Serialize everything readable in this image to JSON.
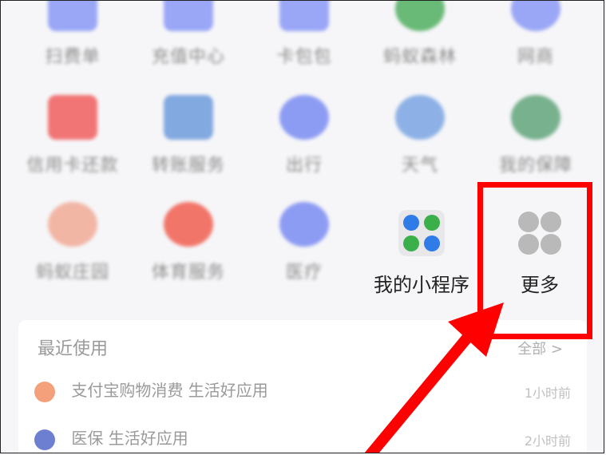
{
  "background_apps": [
    {
      "row": 0,
      "label": "扫费单",
      "color": "#7b8cf5",
      "shape": "sq"
    },
    {
      "row": 0,
      "label": "充值中心",
      "color": "#7b8cf5",
      "shape": "sq"
    },
    {
      "row": 0,
      "label": "卡包包",
      "color": "#7b8cf5",
      "shape": "sq"
    },
    {
      "row": 0,
      "label": "蚂蚁森林",
      "color": "#3aa64b",
      "shape": "circle"
    },
    {
      "row": 0,
      "label": "网商",
      "color": "#7b8cf5",
      "shape": "circle"
    },
    {
      "row": 1,
      "label": "信用卡还款",
      "color": "#f04a4a",
      "shape": "sq"
    },
    {
      "row": 1,
      "label": "转账服务",
      "color": "#5b8fd8",
      "shape": "sq"
    },
    {
      "row": 1,
      "label": "出行",
      "color": "#6a7df2",
      "shape": "circle"
    },
    {
      "row": 1,
      "label": "天气",
      "color": "#6a9ae0",
      "shape": "circle"
    },
    {
      "row": 1,
      "label": "我的保障",
      "color": "#4d9a6a",
      "shape": "circle"
    },
    {
      "row": 2,
      "label": "蚂蚁庄园",
      "color": "#f0a08a",
      "shape": "circle"
    },
    {
      "row": 2,
      "label": "体育服务",
      "color": "#f04a3a",
      "shape": "circle"
    },
    {
      "row": 2,
      "label": "医疗",
      "color": "#6a7df2",
      "shape": "circle"
    }
  ],
  "recent": {
    "title": "最近使用",
    "more": "全部 >",
    "items": [
      {
        "text": "支付宝购物消费  生活好应用",
        "time": "1小时前",
        "color": "#f4a07a"
      },
      {
        "text": "医保  生活好应用",
        "time": "2小时前",
        "color": "#6d7fd0"
      }
    ]
  },
  "mini_program": {
    "label": "我的小程序",
    "quad_colors": [
      "#2f7be8",
      "#3bb04a",
      "#3bb04a",
      "#2f7be8"
    ]
  },
  "more": {
    "label": "更多",
    "dot_color": "#b9b9b9"
  },
  "highlight_color": "#ff0000"
}
